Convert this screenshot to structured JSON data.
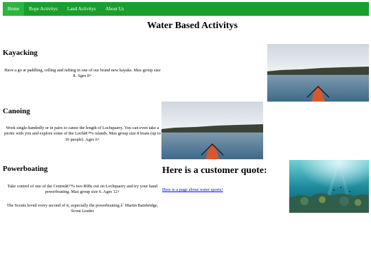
{
  "nav": {
    "items": [
      {
        "label": "Home"
      },
      {
        "label": "Rope Activitys"
      },
      {
        "label": "Land Activitys"
      },
      {
        "label": "About Us"
      }
    ]
  },
  "page": {
    "title": "Water Based Activitys"
  },
  "sections": [
    {
      "heading": "Kayacking",
      "text": "Have a go at paddling, rolling and rafting in one of our brand new kayaks. Max group size 8. Ages 8+"
    },
    {
      "heading": "Canoing",
      "text": "Work single-handedly or in pairs to canoe the length of Lochquarry. You can even take a picnic with you and explore some of the Lochâ€™s islands. Max group size 8 boats (up to 16 people). Ages 6+"
    },
    {
      "heading": "Powerboating",
      "text": "Take control of one of the Centreâ€™s two RIBs out on Lochquarry and try your hand powerboating. Max group size 6. Ages 12+"
    }
  ],
  "quote": {
    "heading": "Here is a customer quote:",
    "link_text": "Here is a page about water sports!",
    "text": "The Scouts loved every second of it, especially the powerboating â˜ Martin Bainbridge, Scout Leader"
  },
  "colors": {
    "nav_background": "#1a9e2c",
    "nav_active": "#2bb53d",
    "link": "#0000ee"
  }
}
